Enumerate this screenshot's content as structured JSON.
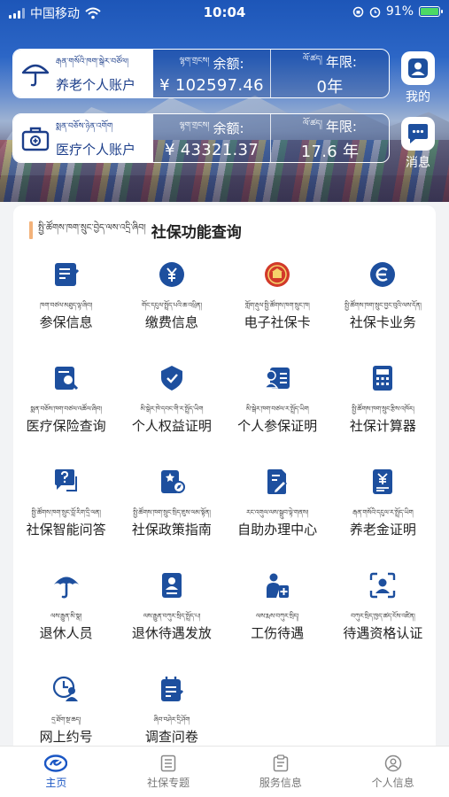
{
  "status_bar": {
    "carrier": "中国移动",
    "time": "10:04",
    "battery": "91%"
  },
  "accounts": [
    {
      "tibetan": "རྒན་གསོའི་ཁག་སྒེར་བཙོལ།",
      "name": "养老个人账户",
      "balance_tibetan": "ལྷག་གྲངས།",
      "balance_label": "余额:",
      "balance": "¥ 102597.46",
      "years_tibetan": "ལོ་ཚད།",
      "years_label": "年限:",
      "years": "0年"
    },
    {
      "tibetan": "སྨན་བཅོས་ཉེན་འགོག",
      "name": "医疗个人账户",
      "balance_tibetan": "ལྷག་གྲངས།",
      "balance_label": "余额:",
      "balance": "¥ 43321.37",
      "years_tibetan": "ལོ་ཚད།",
      "years_label": "年限:",
      "years": "17.6 年"
    }
  ],
  "side_buttons": {
    "profile": "我的",
    "messages": "消息"
  },
  "panel": {
    "title_tibetan": "སྤྱི་ཚོགས་ཁག་སྲུང་བྱེད་ལས་འདྲི་ཞིབ།",
    "title": "社保功能查询"
  },
  "functions": [
    {
      "tibetan": "ཁག་བཙལ་མཐུད་ལྟ་ཞིབ།",
      "label": "参保信息",
      "icon": "checklist-icon"
    },
    {
      "tibetan": "གོང་དངུལ་སྤྲོད་པའི་ཆ་འཕྲིན།",
      "label": "缴费信息",
      "icon": "yuan-coin-icon"
    },
    {
      "tibetan": "གློག་རྡུལ་སྤྱི་ཚོགས་ཁག་སྲུང་ཁ།",
      "label": "电子社保卡",
      "icon": "emblem-icon"
    },
    {
      "tibetan": "སྤྱི་ཚོགས་ཁག་སྲུང་བྱང་བུའི་ལས་དོན།",
      "label": "社保卡业务",
      "icon": "e-card-icon"
    },
    {
      "tibetan": "སྨན་བཅོས་ཁག་བཙལ་འཚོལ་ཞིབ།",
      "label": "医疗保险查询",
      "icon": "doc-search-icon"
    },
    {
      "tibetan": "མི་སྒེར་ཁེ་དབང་གི་ར་སྤྲོད་ཡིག",
      "label": "个人权益证明",
      "icon": "badge-icon"
    },
    {
      "tibetan": "མི་སྒེར་ཁག་བཙལ་ར་སྤྲོད་ཡིག",
      "label": "个人参保证明",
      "icon": "person-card-icon"
    },
    {
      "tibetan": "སྤྱི་ཚོགས་ཁག་སྲུང་རྩིས་འཁོར།",
      "label": "社保计算器",
      "icon": "calculator-icon"
    },
    {
      "tibetan": "སྤྱི་ཚོགས་ཁག་སྲུང་བློ་རིག་དྲི་ལན།",
      "label": "社保智能问答",
      "icon": "question-chat-icon"
    },
    {
      "tibetan": "སྤྱི་ཚོགས་ཁག་སྲུང་སྲིད་ཇུས་ལམ་སྟོན།",
      "label": "社保政策指南",
      "icon": "policy-guide-icon"
    },
    {
      "tibetan": "རང་འགུལ་ལས་སྒྲུབ་ལྟེ་གནས།",
      "label": "自助办理中心",
      "icon": "pen-doc-icon"
    },
    {
      "tibetan": "རྒན་གསོའི་དངུལ་ར་སྤྲོད་ཡིག",
      "label": "养老金证明",
      "icon": "pension-doc-icon"
    },
    {
      "tibetan": "ལས་རྒྱུན་མི་སྣ།",
      "label": "退休人员",
      "icon": "umbrella-icon"
    },
    {
      "tibetan": "ལས་རྒྱུན་བཀུར་སྲིད་སྤྲོད་པ།",
      "label": "退休待遇发放",
      "icon": "id-doc-icon"
    },
    {
      "tibetan": "ལས་རྨས་བཀུར་སྲིད།",
      "label": "工伤待遇",
      "icon": "injury-icon"
    },
    {
      "tibetan": "བཀུར་སྲིད་ཁྱད་ཚད་ངོས་འཛིན།",
      "label": "待遇资格认证",
      "icon": "face-scan-icon"
    },
    {
      "tibetan": "དྲ་ཐོག་སྔ་ཆད།",
      "label": "网上约号",
      "icon": "person-clock-icon"
    },
    {
      "tibetan": "ཞིབ་བཤེར་དྲི་ཤོག",
      "label": "调查问卷",
      "icon": "survey-icon"
    }
  ],
  "tabs": [
    {
      "label": "主页",
      "icon": "home-logo-icon",
      "active": true
    },
    {
      "label": "社保专题",
      "icon": "list-doc-icon",
      "active": false
    },
    {
      "label": "服务信息",
      "icon": "clipboard-icon",
      "active": false
    },
    {
      "label": "个人信息",
      "icon": "person-circle-icon",
      "active": false
    }
  ],
  "colors": {
    "primary": "#1a56c4",
    "icon_blue": "#1d4f9e",
    "accent_bar": "#f3b27a"
  }
}
